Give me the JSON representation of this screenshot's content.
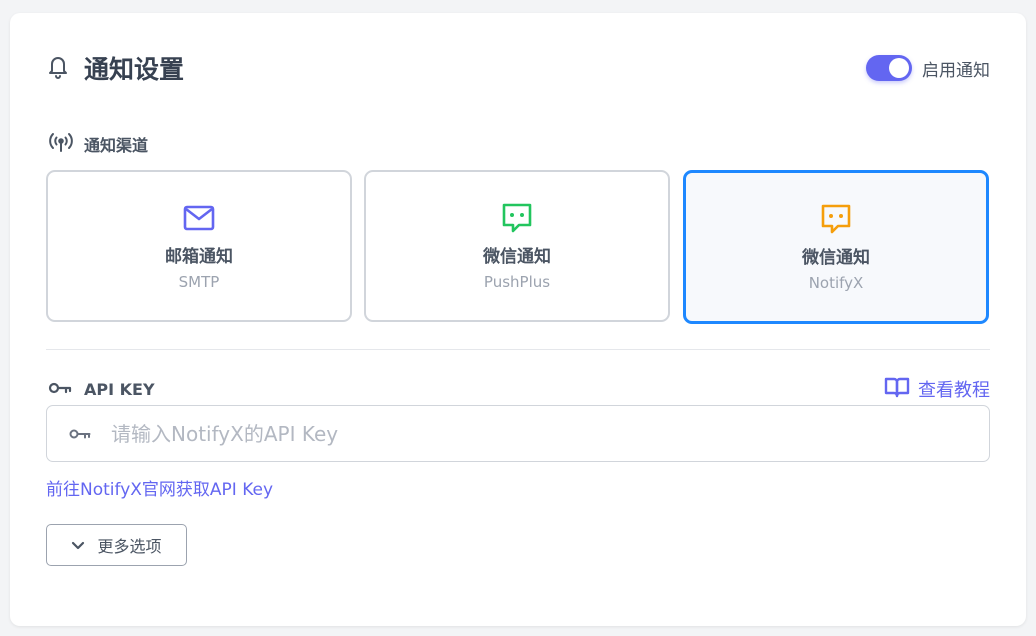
{
  "header": {
    "title": "通知设置",
    "enable_label": "启用通知",
    "enabled": true
  },
  "channels_section": {
    "label": "通知渠道",
    "items": [
      {
        "name": "邮箱通知",
        "sub": "SMTP",
        "icon": "mail-icon",
        "color": "#6366f1",
        "selected": false
      },
      {
        "name": "微信通知",
        "sub": "PushPlus",
        "icon": "chat-icon",
        "color": "#22c55e",
        "selected": false
      },
      {
        "name": "微信通知",
        "sub": "NotifyX",
        "icon": "chat-icon",
        "color": "#f59e0b",
        "selected": true
      }
    ]
  },
  "api_key": {
    "label": "API KEY",
    "tutorial_label": "查看教程",
    "placeholder": "请输入NotifyX的API Key",
    "value": "",
    "get_key_link": "前往NotifyX官网获取API Key"
  },
  "more_options": {
    "label": "更多选项"
  },
  "colors": {
    "accent": "#6366f1",
    "active_border": "#1e88ff"
  }
}
